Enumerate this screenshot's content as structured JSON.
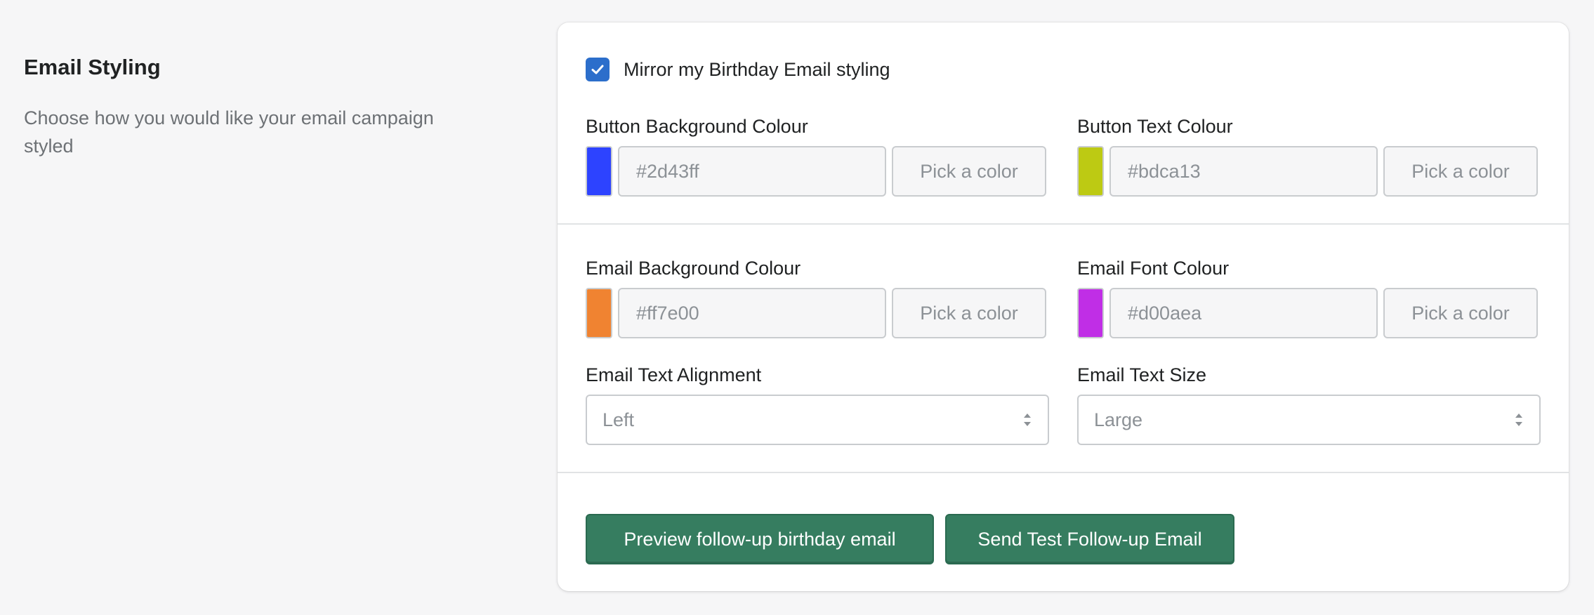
{
  "section": {
    "title": "Email Styling",
    "description": "Choose how you would like your email campaign styled"
  },
  "mirror": {
    "label": "Mirror my Birthday Email styling",
    "checked": true
  },
  "colors": {
    "button_background": {
      "label": "Button Background Colour",
      "value": "#2d43ff",
      "swatch": "#2d43ff",
      "pick_label": "Pick a color"
    },
    "button_text": {
      "label": "Button Text Colour",
      "value": "#bdca13",
      "swatch": "#bdca13",
      "pick_label": "Pick a color"
    },
    "email_background": {
      "label": "Email Background Colour",
      "value": "#ff7e00",
      "swatch": "#f08331",
      "pick_label": "Pick a color"
    },
    "email_font": {
      "label": "Email Font Colour",
      "value": "#d00aea",
      "swatch": "#c02ee6",
      "pick_label": "Pick a color"
    }
  },
  "alignment": {
    "label": "Email Text Alignment",
    "value": "Left"
  },
  "text_size": {
    "label": "Email Text Size",
    "value": "Large"
  },
  "actions": {
    "preview_label": "Preview follow-up birthday email",
    "send_test_label": "Send Test Follow-up Email"
  },
  "theme": {
    "primary": "#367d60",
    "checkbox": "#2c6ecb"
  }
}
